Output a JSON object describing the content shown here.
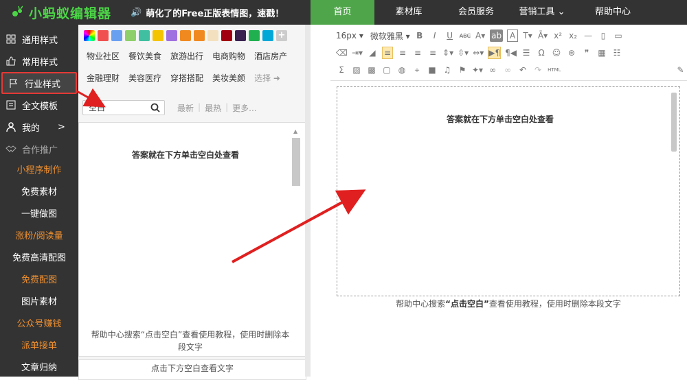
{
  "app": {
    "logo_text": "小蚂蚁编辑器"
  },
  "header": {
    "notice": "萌化了的Free正版表情图，速戳！",
    "nav": [
      {
        "label": "首页",
        "active": true
      },
      {
        "label": "素材库"
      },
      {
        "label": "会员服务"
      },
      {
        "label": "营销工具 ⌄"
      },
      {
        "label": "帮助中心"
      }
    ]
  },
  "sidebar": {
    "items": [
      {
        "label": "通用样式",
        "icon": "grid-icon"
      },
      {
        "label": "常用样式",
        "icon": "thumbs-up-icon"
      },
      {
        "label": "行业样式",
        "icon": "flag-icon",
        "selected": true
      },
      {
        "label": "全文模板",
        "icon": "template-icon"
      },
      {
        "label": "我的",
        "icon": "user-icon",
        "chevron": ">"
      },
      {
        "label": "合作推广",
        "icon": "handshake-icon"
      }
    ],
    "links": [
      {
        "label": "小程序制作",
        "color": "orange"
      },
      {
        "label": "免费素材",
        "color": "white"
      },
      {
        "label": "一键做图",
        "color": "white"
      },
      {
        "label": "涨粉/阅读量",
        "color": "orange"
      },
      {
        "label": "免费高清配图",
        "color": "white"
      },
      {
        "label": "免费配图",
        "color": "orange"
      },
      {
        "label": "图片素材",
        "color": "white"
      },
      {
        "label": "公众号赚钱",
        "color": "orange"
      },
      {
        "label": "派单接单",
        "color": "orange"
      },
      {
        "label": "文章归纳",
        "color": "white"
      }
    ]
  },
  "panel": {
    "swatches": [
      "#f05050",
      "#6aa0f0",
      "#8ecf6a",
      "#40c0a0",
      "#f5c400",
      "#a070e0",
      "#f08a20",
      "#f08a20",
      "#f3e0bf",
      "#a00010",
      "#3a2050",
      "#20b050",
      "#00a8d8"
    ],
    "categories": [
      "物业社区",
      "餐饮美食",
      "旅游出行",
      "电商购物",
      "酒店房产",
      "金融理财",
      "美容医疗",
      "穿搭搭配",
      "美妆美颜",
      "选择"
    ],
    "search_value": "空白",
    "sorts": [
      "最新",
      "|",
      "最热",
      "|",
      "更多..."
    ],
    "card_title": "答案就在下方单击空白处查看",
    "card_foot": "帮助中心搜索“点击空白”查看使用教程，使用时删除本段文字",
    "card2_text": "点击下方空白查看文字"
  },
  "toolbar": {
    "font_size": "16px",
    "font_family": "微软雅黑"
  },
  "editor": {
    "title": "答案就在下方单击空白处查看",
    "foot_prefix": "帮助中心搜索",
    "foot_bold": "“点击空白”",
    "foot_suffix": "查看使用教程，使用时删除本段文字"
  },
  "colors": {
    "accent": "#4fa64a",
    "dark": "#333333",
    "highlight": "#e53935",
    "link_orange": "#f09030"
  }
}
